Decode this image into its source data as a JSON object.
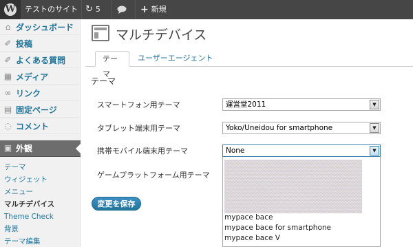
{
  "adminbar": {
    "site_name": "テストのサイト",
    "updates_count": "5",
    "new_label": "新規"
  },
  "sidebar": {
    "items": [
      {
        "label": "ダッシュボード",
        "icon": "dashboard-icon"
      },
      {
        "label": "投稿",
        "icon": "pin-icon"
      },
      {
        "label": "よくある質問",
        "icon": "pin-icon"
      },
      {
        "label": "メディア",
        "icon": "media-icon"
      },
      {
        "label": "リンク",
        "icon": "link-icon"
      },
      {
        "label": "固定ページ",
        "icon": "page-icon"
      },
      {
        "label": "コメント",
        "icon": "comment-icon"
      },
      {
        "label": "外観",
        "icon": "appearance-icon"
      }
    ],
    "submenu": [
      "テーマ",
      "ウィジェット",
      "メニュー",
      "マルチデバイス",
      "Theme Check",
      "背景",
      "テーマ編集"
    ]
  },
  "page": {
    "title": "マルチデバイス",
    "tabs": [
      "テーマ",
      "ユーザーエージェント"
    ],
    "section_title": "テーマ",
    "rows": [
      {
        "label": "スマートフォン用テーマ",
        "value": "運営堂2011"
      },
      {
        "label": "タブレット端末用テーマ",
        "value": "Yoko/Uneidou for smartphone"
      },
      {
        "label": "携帯モバイル端末用テーマ",
        "value": "None"
      },
      {
        "label": "ゲームプラットフォーム用テーマ",
        "value": ""
      }
    ],
    "dropdown_options": [
      "mypace bace",
      "mypace bace for smartphone",
      "mypace bace V"
    ],
    "save_label": "変更を保存"
  },
  "colors": {
    "adminbar": "#464646",
    "link": "#21759b",
    "active_menu": "#6d6d6d",
    "button": "#21759b"
  }
}
